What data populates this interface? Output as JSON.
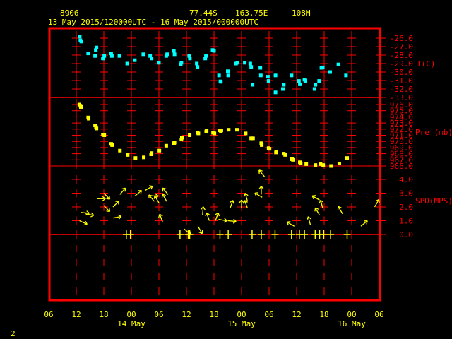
{
  "header": {
    "station": "8906",
    "latitude": "77.44S",
    "longitude": "163.75E",
    "elevation": "108M",
    "period": "13 May 2015/120000UTC - 16 May 2015/000000UTC"
  },
  "page_number": "2",
  "colors": {
    "frame": "#ff0000",
    "text": "#ffff00",
    "temperature": "#00ffff",
    "pressure": "#ffff00",
    "wind": "#ffff00"
  },
  "chart_data": {
    "type": "scatter",
    "x_unit": "hours since 13 May 2015 12 UTC",
    "x_range": [
      -6,
      66
    ],
    "x_tick_labels": [
      "06",
      "12",
      "18",
      "00",
      "06",
      "12",
      "18",
      "00",
      "06",
      "12",
      "18",
      "00",
      "06"
    ],
    "day_labels": [
      {
        "label": "14 May",
        "hour": 12
      },
      {
        "label": "15 May",
        "hour": 36
      },
      {
        "label": "16 May",
        "hour": 60
      }
    ],
    "panels": [
      {
        "name": "temperature",
        "ylabel": "T(C)",
        "ylim": [
          -33,
          -26
        ],
        "tick_labels": [
          "-26.0",
          "-27.0",
          "-28.0",
          "-29.0",
          "-30.0",
          "-31.0",
          "-32.0",
          "-33.0"
        ],
        "points": [
          [
            0.75,
            -25.8
          ],
          [
            0.9,
            -26.25
          ],
          [
            1.1,
            -26.4
          ],
          [
            2.6,
            -27.8
          ],
          [
            4.1,
            -28.1
          ],
          [
            4.25,
            -27.4
          ],
          [
            4.4,
            -27.1
          ],
          [
            5.8,
            -28.4
          ],
          [
            6.1,
            -28.1
          ],
          [
            7.6,
            -27.8
          ],
          [
            7.75,
            -28.1
          ],
          [
            9.4,
            -28.1
          ],
          [
            11.1,
            -29.0
          ],
          [
            12.75,
            -28.6
          ],
          [
            14.6,
            -27.9
          ],
          [
            16.1,
            -28.1
          ],
          [
            16.4,
            -28.4
          ],
          [
            18,
            -28.9
          ],
          [
            19.6,
            -28.1
          ],
          [
            19.8,
            -27.9
          ],
          [
            21.25,
            -27.5
          ],
          [
            21.4,
            -27.9
          ],
          [
            22.75,
            -29.1
          ],
          [
            22.9,
            -28.9
          ],
          [
            24.6,
            -28.1
          ],
          [
            24.75,
            -28.4
          ],
          [
            26.25,
            -29.0
          ],
          [
            26.4,
            -29.4
          ],
          [
            28.1,
            -28.4
          ],
          [
            28.25,
            -28.1
          ],
          [
            29.7,
            -27.4
          ],
          [
            30,
            -27.5
          ],
          [
            31.1,
            -30.4
          ],
          [
            31.4,
            -31.1
          ],
          [
            31.5,
            -31.15
          ],
          [
            33,
            -29.9
          ],
          [
            33.1,
            -30.4
          ],
          [
            34.8,
            -29.0
          ],
          [
            35.1,
            -28.9
          ],
          [
            36.7,
            -28.9
          ],
          [
            37.9,
            -29.0
          ],
          [
            38.1,
            -29.4
          ],
          [
            38.4,
            -31.5
          ],
          [
            40.1,
            -29.5
          ],
          [
            40.2,
            -30.4
          ],
          [
            41.75,
            -30.55
          ],
          [
            41.9,
            -31.05
          ],
          [
            43.4,
            -30.4
          ],
          [
            43.4,
            -32.4
          ],
          [
            45,
            -32.0
          ],
          [
            45.2,
            -31.5
          ],
          [
            46.9,
            -30.4
          ],
          [
            48.5,
            -31.05
          ],
          [
            48.7,
            -31.45
          ],
          [
            49.7,
            -30.9
          ],
          [
            49.9,
            -31.05
          ],
          [
            51.9,
            -32.0
          ],
          [
            52.1,
            -31.5
          ],
          [
            52.9,
            -31.05
          ],
          [
            53.4,
            -29.5
          ],
          [
            53.7,
            -29.45
          ],
          [
            55.3,
            -30.0
          ],
          [
            57.1,
            -29.1
          ],
          [
            58.75,
            -30.4
          ]
        ]
      },
      {
        "name": "pressure",
        "ylabel": "Pre (mb)",
        "ylim": [
          966,
          976
        ],
        "tick_labels": [
          "976.0",
          "975.0",
          "974.0",
          "973.0",
          "972.0",
          "971.0",
          "970.0",
          "969.0",
          "968.0",
          "967.0",
          "966.0"
        ],
        "points": [
          [
            0.67,
            976.0
          ],
          [
            0.9,
            975.8
          ],
          [
            1.0,
            975.6
          ],
          [
            2.6,
            973.9
          ],
          [
            2.7,
            973.7
          ],
          [
            4.1,
            972.6
          ],
          [
            4.3,
            972.3
          ],
          [
            4.4,
            972.1
          ],
          [
            5.8,
            971.1
          ],
          [
            6.1,
            971.0
          ],
          [
            7.6,
            969.6
          ],
          [
            7.8,
            969.4
          ],
          [
            9.5,
            968.5
          ],
          [
            11.2,
            967.8
          ],
          [
            12.9,
            967.3
          ],
          [
            14.7,
            967.4
          ],
          [
            16.3,
            967.9
          ],
          [
            16.4,
            968.1
          ],
          [
            18.1,
            968.5
          ],
          [
            19.6,
            969.3
          ],
          [
            21.3,
            969.7
          ],
          [
            21.4,
            969.8
          ],
          [
            22.9,
            970.3
          ],
          [
            23.0,
            970.6
          ],
          [
            24.7,
            971.0
          ],
          [
            26.4,
            971.4
          ],
          [
            26.6,
            971.3
          ],
          [
            28.3,
            971.6
          ],
          [
            28.4,
            971.7
          ],
          [
            29.8,
            971.4
          ],
          [
            30.1,
            971.3
          ],
          [
            31.2,
            971.8
          ],
          [
            31.5,
            971.6
          ],
          [
            31.6,
            971.8
          ],
          [
            33.2,
            971.9
          ],
          [
            35.0,
            971.9
          ],
          [
            36.9,
            971.3
          ],
          [
            38.1,
            970.5
          ],
          [
            38.5,
            970.5
          ],
          [
            40.3,
            969.7
          ],
          [
            40.4,
            969.4
          ],
          [
            41.9,
            968.9
          ],
          [
            42.1,
            968.8
          ],
          [
            43.5,
            968.2
          ],
          [
            43.6,
            968.3
          ],
          [
            45.2,
            968.0
          ],
          [
            45.5,
            967.8
          ],
          [
            47.0,
            967.1
          ],
          [
            47.2,
            967.0
          ],
          [
            48.7,
            966.6
          ],
          [
            48.9,
            966.4
          ],
          [
            50.1,
            966.3
          ],
          [
            52.1,
            966.15
          ],
          [
            53.2,
            966.3
          ],
          [
            53.8,
            966.15
          ],
          [
            55.5,
            966.0
          ],
          [
            57.3,
            966.4
          ],
          [
            59.0,
            967.3
          ]
        ]
      },
      {
        "name": "wind",
        "ylabel": "SPD(MPS)",
        "ylim": [
          0,
          4
        ],
        "tick_labels": [
          "4.0",
          "3.0",
          "2.0",
          "1.0",
          "0.0"
        ],
        "arrows_hour_speed_direction": [
          [
            0.7,
            1.0,
            115
          ],
          [
            1.0,
            1.6,
            95
          ],
          [
            2.0,
            1.5,
            100
          ],
          [
            4.5,
            2.6,
            90
          ],
          [
            6.0,
            3.0,
            135
          ],
          [
            6.0,
            2.1,
            135
          ],
          [
            8.0,
            2.0,
            45
          ],
          [
            8.0,
            1.2,
            80
          ],
          [
            9.5,
            2.9,
            40
          ],
          [
            12.8,
            2.8,
            50
          ],
          [
            15,
            3.2,
            60
          ],
          [
            16,
            2.8,
            90
          ],
          [
            17,
            2.4,
            320
          ],
          [
            18,
            2.3,
            330
          ],
          [
            19.7,
            2.4,
            330
          ],
          [
            20,
            2.9,
            320
          ],
          [
            18.8,
            0.9,
            340
          ],
          [
            23.5,
            0.4,
            130
          ],
          [
            26.5,
            0.6,
            150
          ],
          [
            27.5,
            1.4,
            5
          ],
          [
            29,
            1.0,
            340
          ],
          [
            30.3,
            1.0,
            20
          ],
          [
            31,
            1.1,
            100
          ],
          [
            33,
            1.0,
            95
          ],
          [
            33.5,
            1.9,
            20
          ],
          [
            36,
            1.9,
            0
          ],
          [
            37.3,
            1.9,
            340
          ],
          [
            37.3,
            2.4,
            345
          ],
          [
            40.3,
            2.9,
            0
          ],
          [
            40.5,
            2.7,
            300
          ],
          [
            41,
            4.2,
            320
          ],
          [
            47.5,
            0.6,
            300
          ],
          [
            51,
            0.7,
            345
          ],
          [
            53,
            1.4,
            330
          ],
          [
            53,
            2.5,
            300
          ],
          [
            53.7,
            1.9,
            345
          ],
          [
            58,
            1.5,
            330
          ],
          [
            62,
            0.6,
            50
          ],
          [
            65,
            2.0,
            30
          ]
        ],
        "calm_hours": [
          10.9,
          11.8,
          22.6,
          24.4,
          24.7,
          31.3,
          33.1,
          38.3,
          40.3,
          43.3,
          46.9,
          48.6,
          49.7,
          52.05,
          53,
          53.9,
          55.4,
          59
        ]
      }
    ]
  }
}
